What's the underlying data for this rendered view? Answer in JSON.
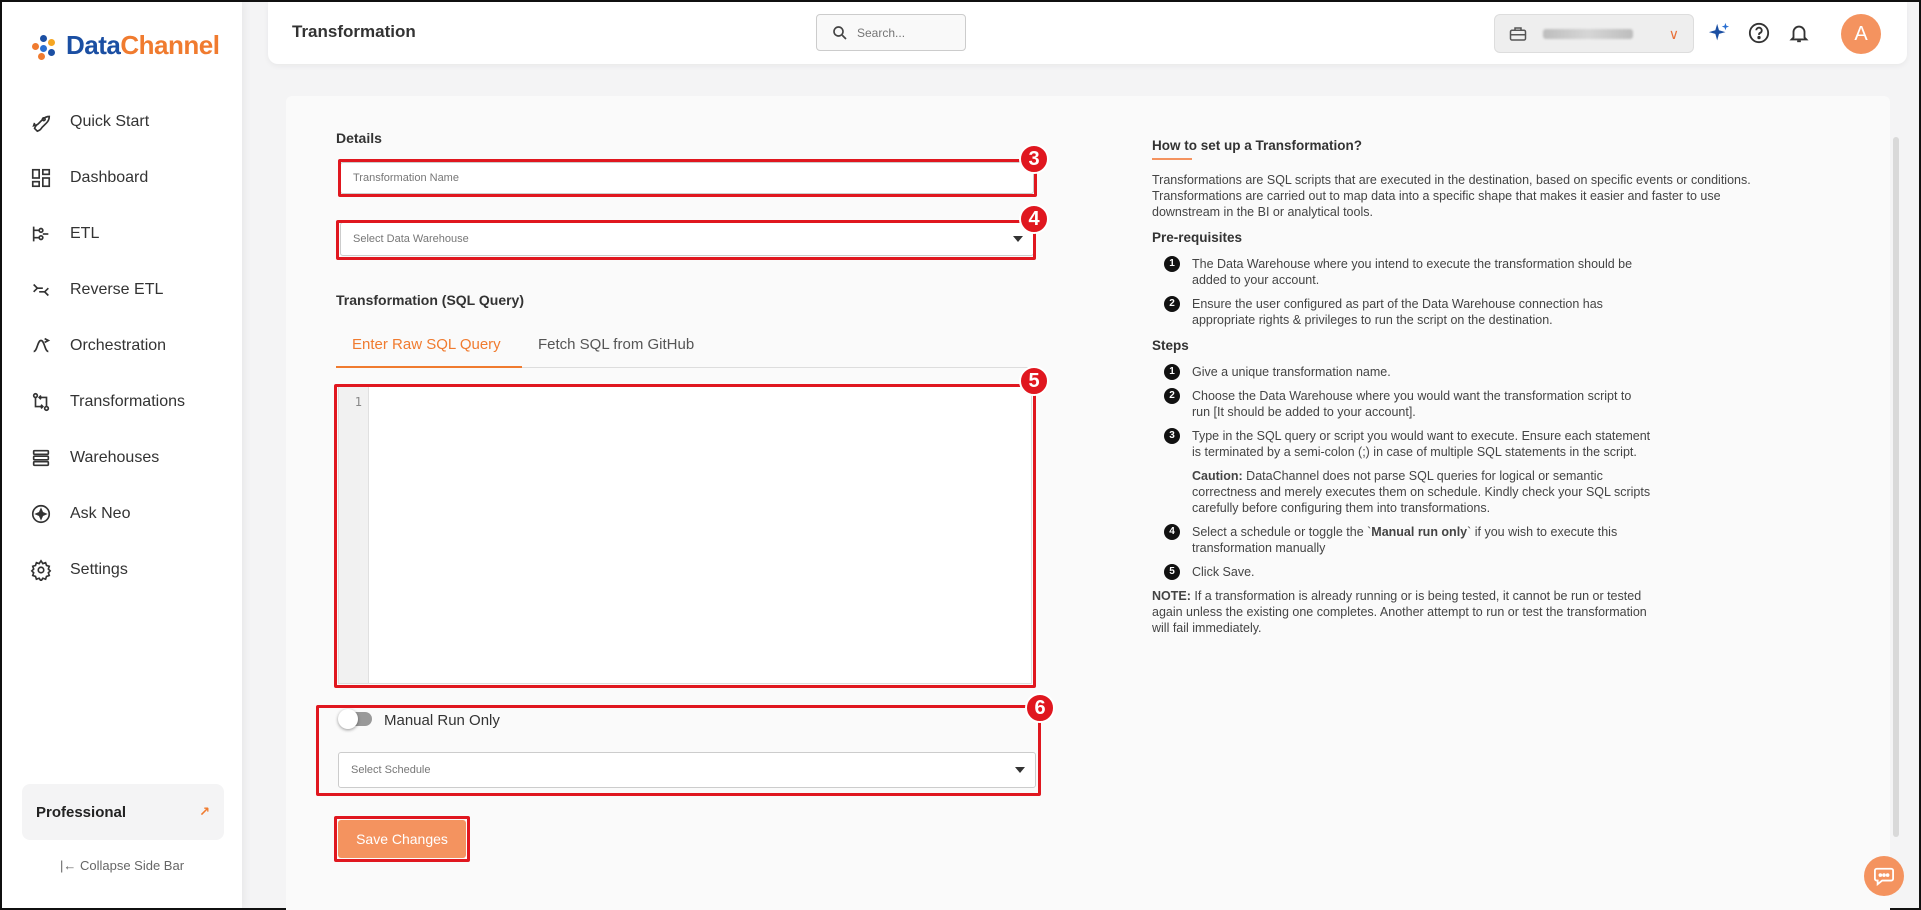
{
  "brand": {
    "name_part1": "Data",
    "name_part2": "Channel"
  },
  "sidebar": {
    "items": [
      {
        "label": "Quick Start",
        "icon": "rocket-icon"
      },
      {
        "label": "Dashboard",
        "icon": "dashboard-icon"
      },
      {
        "label": "ETL",
        "icon": "etl-icon"
      },
      {
        "label": "Reverse ETL",
        "icon": "reverse-etl-icon"
      },
      {
        "label": "Orchestration",
        "icon": "orchestration-icon"
      },
      {
        "label": "Transformations",
        "icon": "transformations-icon"
      },
      {
        "label": "Warehouses",
        "icon": "warehouses-icon"
      },
      {
        "label": "Ask Neo",
        "icon": "ask-neo-icon"
      },
      {
        "label": "Settings",
        "icon": "gear-icon"
      }
    ],
    "plan": "Professional",
    "collapse_label": "Collapse Side Bar"
  },
  "header": {
    "title": "Transformation",
    "search_placeholder": "Search...",
    "avatar_initial": "A",
    "colors": {
      "accent": "#f07b2f",
      "avatar": "#f4935f",
      "annotation": "#e0171f"
    }
  },
  "form": {
    "details_label": "Details",
    "name_placeholder": "Transformation Name",
    "warehouse_placeholder": "Select Data Warehouse",
    "sql_label": "Transformation (SQL Query)",
    "tabs": [
      {
        "label": "Enter Raw SQL Query",
        "active": true
      },
      {
        "label": "Fetch SQL from GitHub",
        "active": false
      }
    ],
    "editor_line": "1",
    "manual_run_label": "Manual Run Only",
    "manual_run_on": false,
    "schedule_placeholder": "Select Schedule",
    "save_label": "Save Changes"
  },
  "annotations": [
    "3",
    "4",
    "5",
    "6"
  ],
  "help": {
    "title": "How to set up a Transformation?",
    "intro1": "Transformations are SQL scripts that are executed in the destination, based on specific events or conditions.",
    "intro2": "Transformations are carried out to map data into a specific shape that makes it easier and faster to use downstream in the BI or analytical tools.",
    "prereq_title": "Pre-requisites",
    "prereqs": [
      "The Data Warehouse where you intend to execute the transformation should be added to your account.",
      "Ensure the user configured as part of the Data Warehouse connection has appropriate rights & privileges to run the script on the destination."
    ],
    "steps_title": "Steps",
    "steps": [
      "Give a unique transformation name.",
      "Choose the Data Warehouse where you would want the transformation script to run [It should be added to your account].",
      "Type in the SQL query or script you would want to execute. Ensure each statement is terminated by a semi-colon (;) in case of multiple SQL statements in the script."
    ],
    "caution_label": "Caution:",
    "caution_text": " DataChannel does not parse SQL queries for logical or semantic correctness and merely executes them on schedule. Kindly check your SQL scripts carefully before configuring them into transformations.",
    "step4_pre": "Select a schedule or toggle the `",
    "step4_bold": "Manual run only",
    "step4_post": "` if you wish to execute this transformation manually",
    "step5": "Click Save.",
    "note_label": "NOTE:",
    "note_text": " If a transformation is already running or is being tested, it cannot be run or tested again unless the existing one completes. Another attempt to run or test the transformation will fail immediately."
  }
}
